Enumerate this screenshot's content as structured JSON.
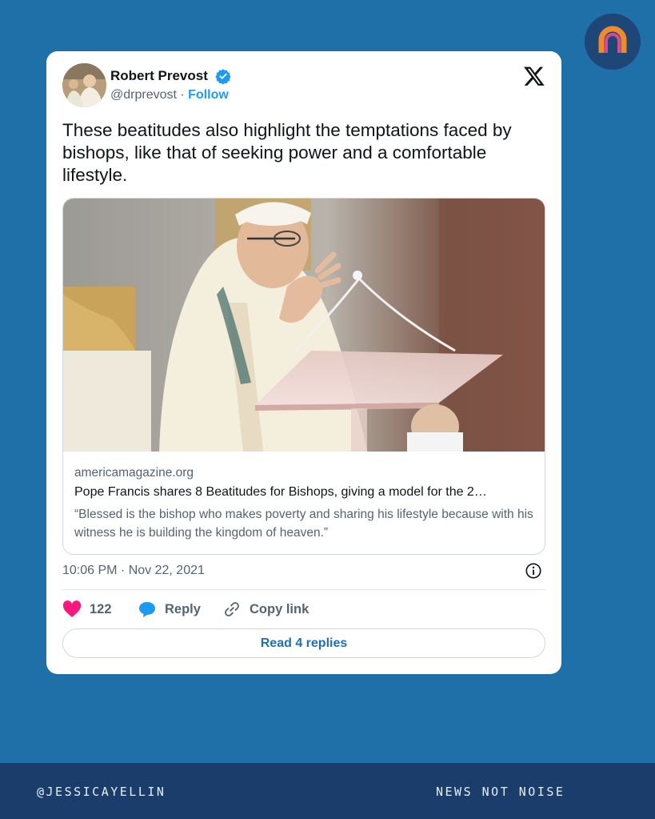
{
  "brand": {
    "icon": "brand-n-logo-icon",
    "bg_color": "#1e4677"
  },
  "tweet": {
    "author_name": "Robert Prevost",
    "verified_icon": "verified-badge-icon",
    "handle": "@drprevost",
    "separator": "·",
    "follow_label": "Follow",
    "platform_icon": "x-logo-icon",
    "text": "These beatitudes also highlight the temptations faced by bishops, like that of seeking power and a comfortable lifestyle.",
    "link_card": {
      "image": "photo-pope-at-lectern",
      "domain": "americamagazine.org",
      "title": "Pope Francis shares 8 Beatitudes for Bishops, giving a model for the 2…",
      "description": "“Blessed is the bishop who makes poverty and sharing his lifestyle because with his witness he is building the kingdom of heaven.”"
    },
    "timestamp": "10:06 PM · Nov 22, 2021",
    "info_icon": "info-icon",
    "actions": {
      "like_count": "122",
      "reply_label": "Reply",
      "copy_link_label": "Copy link"
    },
    "read_replies_label": "Read 4 replies",
    "colors": {
      "like": "#f91880",
      "accent": "#1d9bf0"
    }
  },
  "footer": {
    "left_text": "@JESSICAYELLIN",
    "right_text": "NEWS NOT NOISE"
  },
  "colors": {
    "page_bg": "#1f6fa8",
    "footer_bg": "#1a3d6b"
  }
}
